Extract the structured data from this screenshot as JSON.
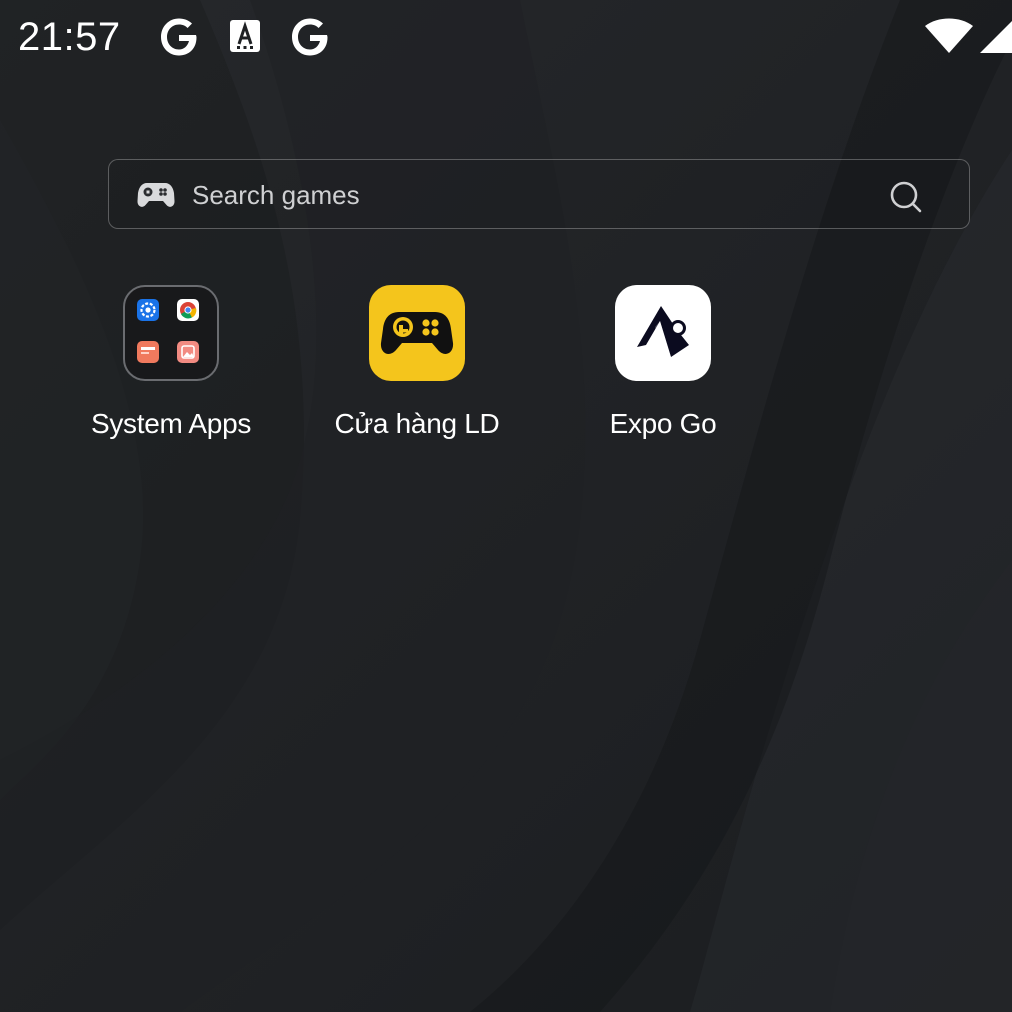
{
  "status_bar": {
    "time": "21:57",
    "notification_icons": [
      "google-icon",
      "keyboard-a-icon",
      "google-icon"
    ],
    "system_icons": [
      "wifi-icon",
      "cell-signal-icon"
    ]
  },
  "search": {
    "placeholder": "Search games",
    "left_icon": "gamepad-icon",
    "right_icon": "search-icon"
  },
  "apps": [
    {
      "label": "System Apps",
      "type": "folder",
      "contents": [
        "settings-icon",
        "chrome-icon",
        "file-manager-icon",
        "gallery-icon"
      ]
    },
    {
      "label": "Cửa hàng LD",
      "type": "app",
      "icon": "ld-store-icon",
      "icon_color": "#f4c51c"
    },
    {
      "label": "Expo Go",
      "type": "app",
      "icon": "expo-go-icon",
      "icon_color": "#ffffff"
    }
  ],
  "colors": {
    "background": "#1f2124",
    "ld_yellow": "#f4c51c",
    "text": "#ffffff"
  }
}
